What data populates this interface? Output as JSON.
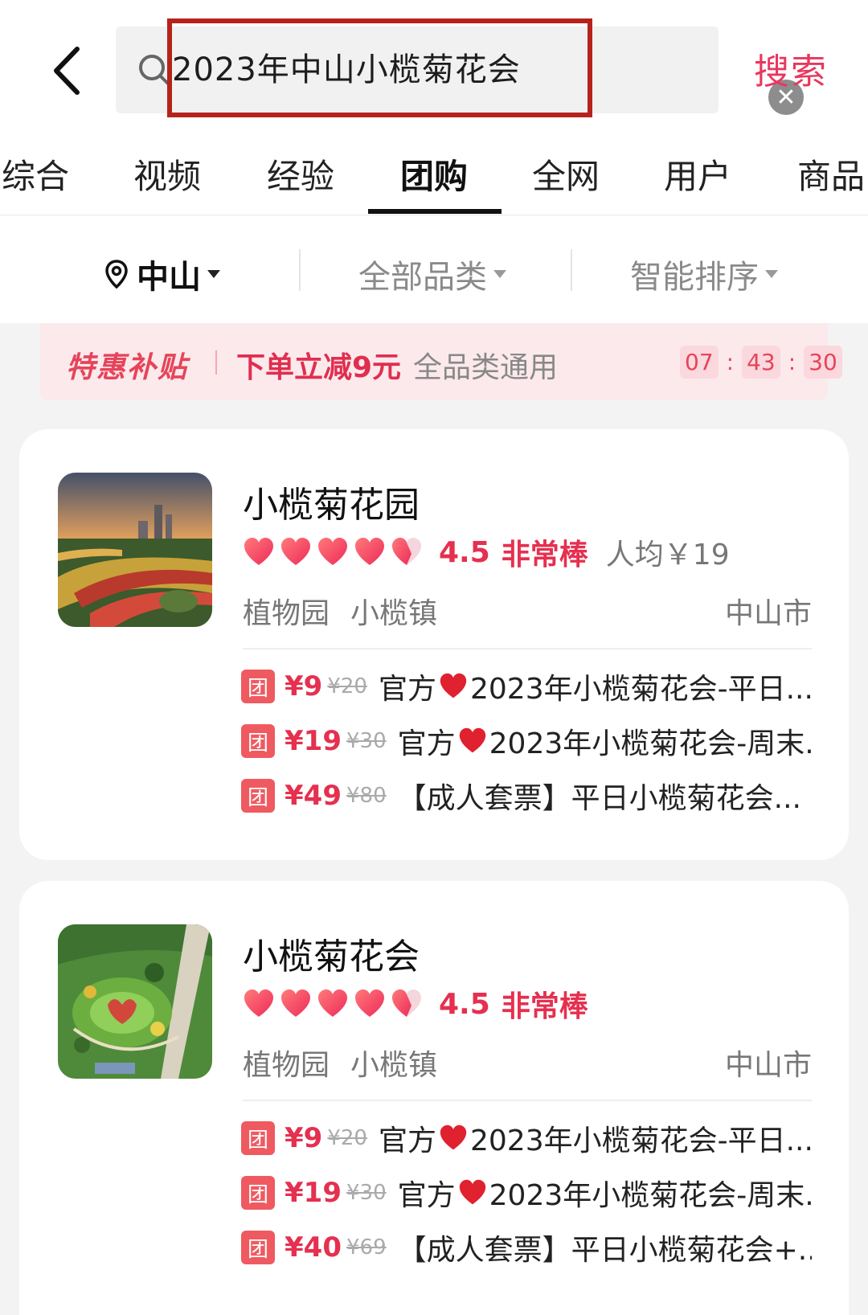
{
  "search": {
    "query": "2023年中山小榄菊花会",
    "submit_label": "搜索"
  },
  "tabs": [
    {
      "label": "综合"
    },
    {
      "label": "视频"
    },
    {
      "label": "经验"
    },
    {
      "label": "团购",
      "active": true
    },
    {
      "label": "全网"
    },
    {
      "label": "用户"
    },
    {
      "label": "商品"
    }
  ],
  "filters": {
    "location": "中山",
    "category": "全部品类",
    "sort": "智能排序"
  },
  "promo": {
    "tag": "特惠补贴",
    "main": "下单立减9元",
    "sub": "全品类通用",
    "countdown": {
      "h": "07",
      "m": "43",
      "s": "30"
    }
  },
  "colors": {
    "accent": "#e5304f",
    "highlight_border": "#b5231b",
    "badge": "#ef5a61"
  },
  "results": [
    {
      "name": "小榄菊花园",
      "hearts": 4.5,
      "score": "4.5",
      "praise": "非常棒",
      "avg_price": "人均￥19",
      "tags": [
        "植物园",
        "小榄镇"
      ],
      "city": "中山市",
      "deals": [
        {
          "badge": "团",
          "price": "¥9",
          "orig": "¥20",
          "prefix": "官方",
          "has_heart": true,
          "title": "2023年小榄菊花会-平日..."
        },
        {
          "badge": "团",
          "price": "¥19",
          "orig": "¥30",
          "prefix": "官方",
          "has_heart": true,
          "title": "2023年小榄菊花会-周末..."
        },
        {
          "badge": "团",
          "price": "¥49",
          "orig": "¥80",
          "prefix": "",
          "has_heart": false,
          "title": "【成人套票】平日小榄菊花会..."
        }
      ]
    },
    {
      "name": "小榄菊花会",
      "hearts": 4.5,
      "score": "4.5",
      "praise": "非常棒",
      "avg_price": "",
      "tags": [
        "植物园",
        "小榄镇"
      ],
      "city": "中山市",
      "deals": [
        {
          "badge": "团",
          "price": "¥9",
          "orig": "¥20",
          "prefix": "官方",
          "has_heart": true,
          "title": "2023年小榄菊花会-平日..."
        },
        {
          "badge": "团",
          "price": "¥19",
          "orig": "¥30",
          "prefix": "官方",
          "has_heart": true,
          "title": "2023年小榄菊花会-周末..."
        },
        {
          "badge": "团",
          "price": "¥40",
          "orig": "¥69",
          "prefix": "",
          "has_heart": false,
          "title": "【成人套票】平日小榄菊花会+..."
        }
      ]
    }
  ]
}
